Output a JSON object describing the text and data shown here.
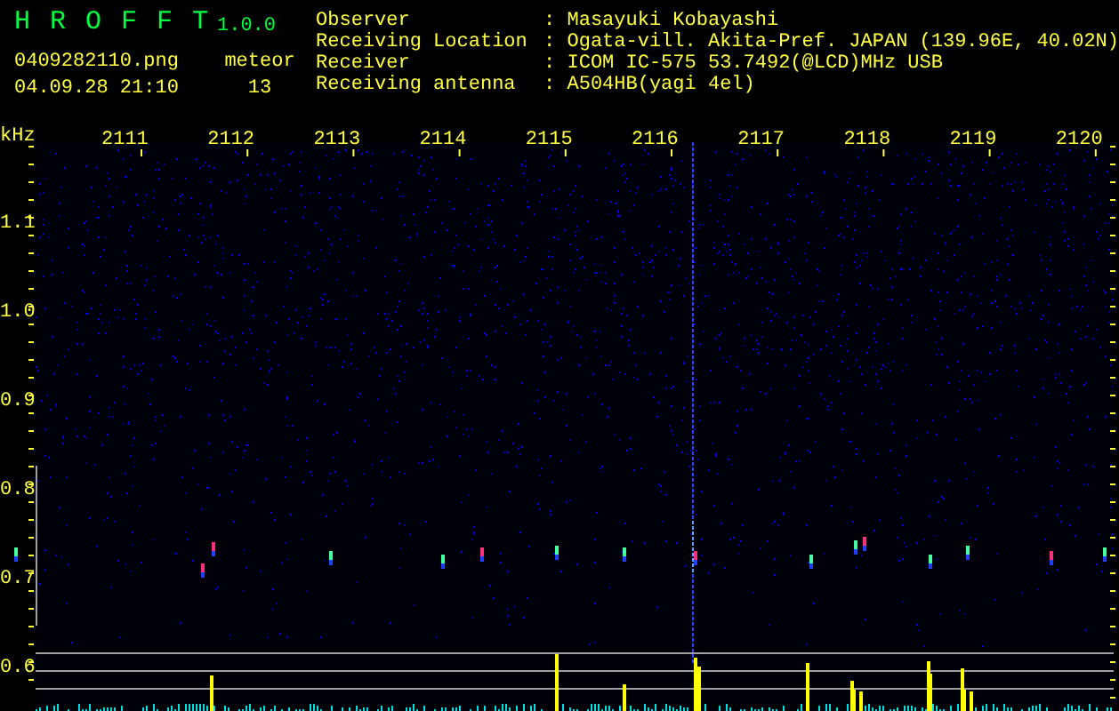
{
  "app": {
    "title": "H R O F F T",
    "version": "1.0.0",
    "file": "0409282110.png",
    "datetime": "04.09.28 21:10",
    "meteor_label": "meteor",
    "meteor_count": "13"
  },
  "station": [
    {
      "label": "Observer",
      "value": ": Masayuki Kobayashi"
    },
    {
      "label": "Receiving Location",
      "value": ": Ogata-vill. Akita-Pref. JAPAN (139.96E, 40.02N)"
    },
    {
      "label": "Receiver",
      "value": ": ICOM IC-575 53.7492(@LCD)MHz USB"
    },
    {
      "label": "Receiving antenna",
      "value": ": A504HB(yagi 4el)"
    }
  ],
  "spectrogram": {
    "unit": "kHz",
    "frequency_labels": [
      "1.1",
      "1.0",
      "0.9",
      "0.8",
      "0.7",
      "0.6"
    ],
    "time_labels": [
      "2111",
      "2112",
      "2113",
      "2114",
      "2115",
      "2116",
      "2117",
      "2118",
      "2119",
      "2120"
    ]
  }
}
